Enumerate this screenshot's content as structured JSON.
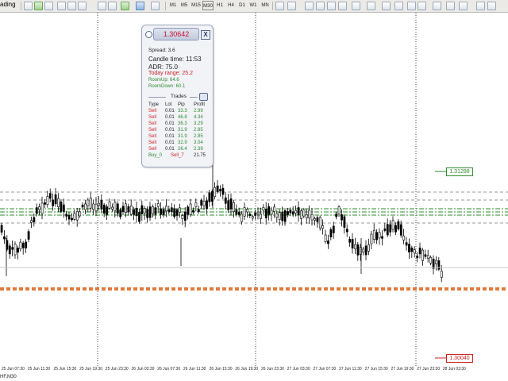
{
  "toolbar": {
    "menu_fragment": "ading",
    "timeframes": [
      "M1",
      "M5",
      "M15",
      "M30",
      "H1",
      "H4",
      "D1",
      "W1",
      "MN"
    ]
  },
  "panel": {
    "price": "1.30642",
    "close_label": "X",
    "spread": "Spread: 3.6",
    "candle_time": "Candle time: 11:53",
    "adr": "ADR: 75.0",
    "today_range": "Today range: 25.2",
    "room_up": "RoomUp: 64.6",
    "room_down": "RoomDown: 60.1",
    "trades_title": "Trades",
    "headers": [
      "Type",
      "Lot",
      "Pip",
      "Profit"
    ],
    "trades": [
      {
        "type": "Sell",
        "lot": "0.01",
        "pip": "33.3",
        "profit": "2.99"
      },
      {
        "type": "Sell",
        "lot": "0.01",
        "pip": "46.8",
        "profit": "4.34"
      },
      {
        "type": "Sell",
        "lot": "0.01",
        "pip": "36.3",
        "profit": "3.29"
      },
      {
        "type": "Sell",
        "lot": "0.01",
        "pip": "31.9",
        "profit": "2.85"
      },
      {
        "type": "Sell",
        "lot": "0.01",
        "pip": "31.9",
        "profit": "2.85"
      },
      {
        "type": "Sell",
        "lot": "0.01",
        "pip": "32.9",
        "profit": "3.04"
      },
      {
        "type": "Sell",
        "lot": "0.01",
        "pip": "26.4",
        "profit": "2.39"
      }
    ],
    "summary": {
      "buy": "Buy_0",
      "sell": "Sell_7",
      "total": "21.75"
    }
  },
  "price_labels": {
    "high": "1.31288",
    "low": "1.30040"
  },
  "symbol": "HF,M30",
  "x_axis": [
    "25 Jun 07:30",
    "25 Jun 11:30",
    "25 Jun 15:30",
    "25 Jun 19:30",
    "25 Jun 23:30",
    "26 Jun 03:30",
    "26 Jun 07:30",
    "26 Jun 11:30",
    "26 Jun 15:30",
    "26 Jun 19:30",
    "26 Jun 23:30",
    "27 Jun 03:30",
    "27 Jun 07:30",
    "27 Jun 11:30",
    "27 Jun 15:30",
    "27 Jun 19:30",
    "27 Jun 23:30",
    "28 Jun 03:30"
  ],
  "colors": {
    "bull": "#000000",
    "bear": "#000000",
    "gray_levels": "#9a9a9a",
    "green_levels": "#2e8b2e",
    "orange_band": "#e07a3a",
    "high_label": "#2e8b2e",
    "low_label": "#cc2222",
    "sell": "#cc2222",
    "pip": "#2e8b2e",
    "price_text": "#c8102e"
  }
}
